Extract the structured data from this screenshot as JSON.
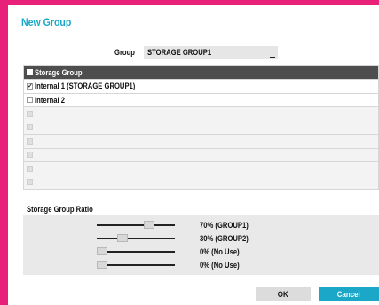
{
  "dialog": {
    "title": "New Group"
  },
  "group": {
    "label": "Group",
    "value": "STORAGE GROUP1"
  },
  "table": {
    "header": "Storage Group",
    "rows": [
      {
        "label": "Internal 1 (STORAGE GROUP1)",
        "checked": true
      },
      {
        "label": "Internal 2",
        "checked": false
      },
      {
        "label": "",
        "checked": false
      },
      {
        "label": "",
        "checked": false
      },
      {
        "label": "",
        "checked": false
      },
      {
        "label": "",
        "checked": false
      },
      {
        "label": "",
        "checked": false
      },
      {
        "label": "",
        "checked": false
      }
    ]
  },
  "ratio": {
    "title": "Storage Group Ratio",
    "items": [
      {
        "text": "70% (GROUP1)",
        "value": 0.7
      },
      {
        "text": "30% (GROUP2)",
        "value": 0.3
      },
      {
        "text": "0% (No Use)",
        "value": 0.0
      },
      {
        "text": "0% (No Use)",
        "value": 0.0
      }
    ]
  },
  "buttons": {
    "ok": "OK",
    "cancel": "Cancel"
  },
  "colors": {
    "accent": "#1aa7c8",
    "frame": "#e8207a",
    "header": "#4e4e4e"
  },
  "icons": {
    "checkbox_checked": "check-icon"
  }
}
